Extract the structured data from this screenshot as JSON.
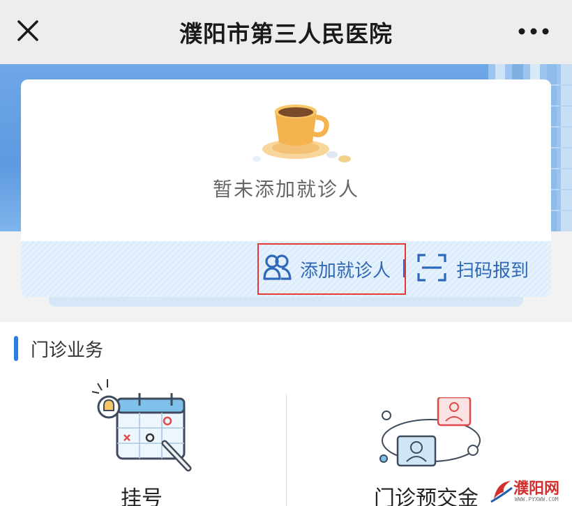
{
  "header": {
    "title": "濮阳市第三人民医院",
    "close_icon": "close-icon",
    "more_icon": "more-horizontal-icon"
  },
  "patient_card": {
    "empty_text": "暂未添加就诊人",
    "add_label": "添加就诊人",
    "scan_label": "扫码报到",
    "add_icon": "users-icon",
    "scan_icon": "scan-icon"
  },
  "services": {
    "section_title": "门诊业务",
    "items": [
      {
        "label": "挂号",
        "icon": "calendar-register-icon"
      },
      {
        "label": "门诊预交金",
        "icon": "outpatient-prepay-icon"
      }
    ]
  },
  "watermark": {
    "text": "濮阳网",
    "url": "WWW.PYXWW.COM"
  },
  "colors": {
    "accent": "#2a7de1",
    "action_text": "#2f68b8",
    "highlight": "#e53935",
    "banner": "#5d9ae0"
  }
}
